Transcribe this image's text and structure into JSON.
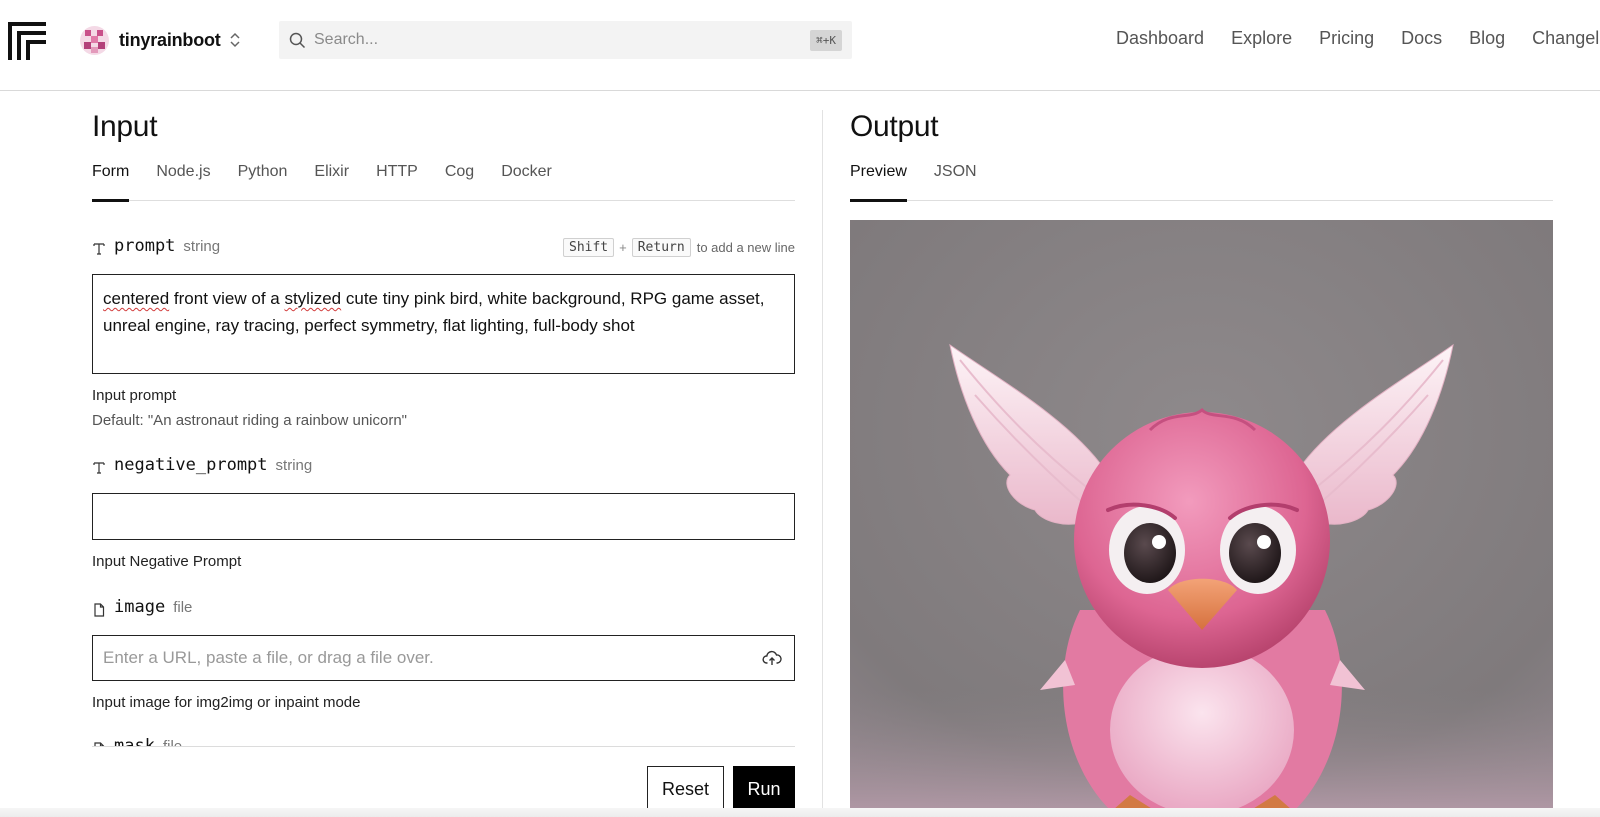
{
  "header": {
    "account_name": "tinyrainboot",
    "search_placeholder": "Search...",
    "search_shortcut": "⌘+K",
    "nav": [
      "Dashboard",
      "Explore",
      "Pricing",
      "Docs",
      "Blog",
      "Changelog"
    ]
  },
  "input_panel": {
    "title": "Input",
    "tabs": [
      "Form",
      "Node.js",
      "Python",
      "Elixir",
      "HTTP",
      "Cog",
      "Docker"
    ],
    "active_tab": "Form",
    "hint": {
      "key1": "Shift",
      "plus": "+",
      "key2": "Return",
      "text": "to add a new line"
    },
    "fields": {
      "prompt": {
        "name": "prompt",
        "type": "string",
        "value_word1": "centered",
        "value_mid1": " front view of a ",
        "value_word2": "stylized",
        "value_rest": " cute tiny pink bird, white background, RPG game asset, unreal engine, ray tracing, perfect symmetry, flat lighting, full-body shot",
        "description": "Input prompt",
        "default": "Default: \"An astronaut riding a rainbow unicorn\""
      },
      "negative_prompt": {
        "name": "negative_prompt",
        "type": "string",
        "value": "",
        "description": "Input Negative Prompt"
      },
      "image": {
        "name": "image",
        "type": "file",
        "placeholder": "Enter a URL, paste a file, or drag a file over.",
        "description": "Input image for img2img or inpaint mode"
      },
      "mask": {
        "name": "mask",
        "type": "file"
      }
    },
    "buttons": {
      "reset": "Reset",
      "run": "Run"
    }
  },
  "output_panel": {
    "title": "Output",
    "tabs": [
      "Preview",
      "JSON"
    ],
    "active_tab": "Preview"
  },
  "colors": {
    "accent": "#000000",
    "preview_bg": "#8a8587",
    "bird_pink": "#e0709a"
  },
  "icons": [
    "logo-icon",
    "avatar-icon",
    "chevron-updown-icon",
    "search-icon",
    "text-type-icon",
    "file-icon",
    "upload-cloud-icon"
  ]
}
